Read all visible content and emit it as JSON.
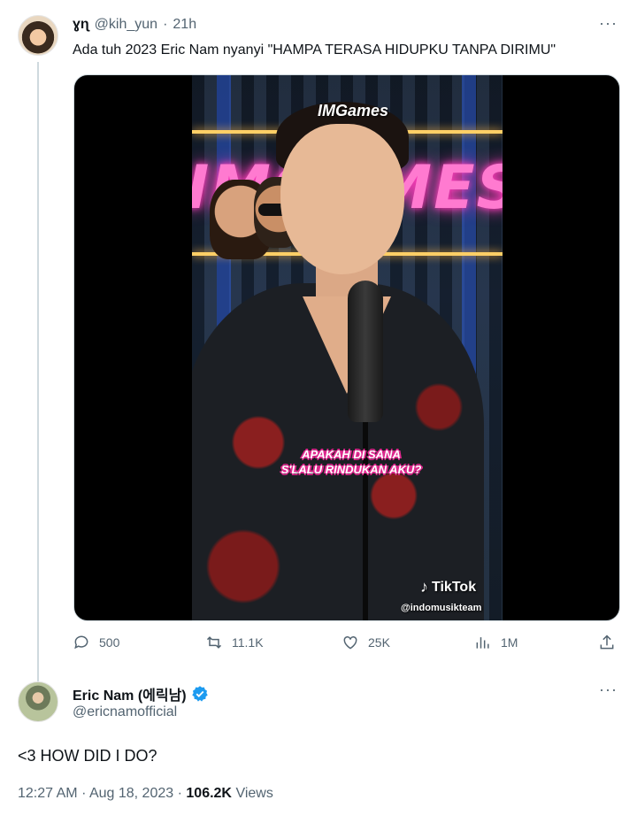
{
  "tweet1": {
    "display_name": "ɣɳ",
    "handle": "@kih_yun",
    "separator": "·",
    "time": "21h",
    "more": "···",
    "text": "Ada tuh 2023 Eric Nam nyanyi \"HAMPA TERASA HIDUPKU TANPA DIRIMU\""
  },
  "media": {
    "imgames_label": "IMGames",
    "neon_sign": "IMGAMES",
    "subtitle_line1": "APAKAH DI SANA",
    "subtitle_line2": "S'LALU RINDUKAN AKU?",
    "tiktok_logo": "TikTok",
    "tiktok_handle": "@indomusikteam"
  },
  "actions": {
    "reply_count": "500",
    "retweet_count": "11.1K",
    "like_count": "25K",
    "views_count": "1M"
  },
  "tweet2": {
    "display_name": "Eric Nam (에릭남)",
    "handle": "@ericnamofficial",
    "more": "···",
    "text": "<3 HOW DID I DO?",
    "time": "12:27 AM",
    "separator": "·",
    "date": "Aug 18, 2023",
    "views_count": "106.2K",
    "views_label": "Views"
  },
  "colors": {
    "text_primary": "#0f1419",
    "text_secondary": "#536471",
    "verified_blue": "#1d9bf0",
    "neon_pink": "#ff7ad0"
  },
  "icons": [
    "reply-icon",
    "retweet-icon",
    "like-icon",
    "views-icon",
    "share-icon",
    "verified-badge-icon",
    "tiktok-icon"
  ]
}
